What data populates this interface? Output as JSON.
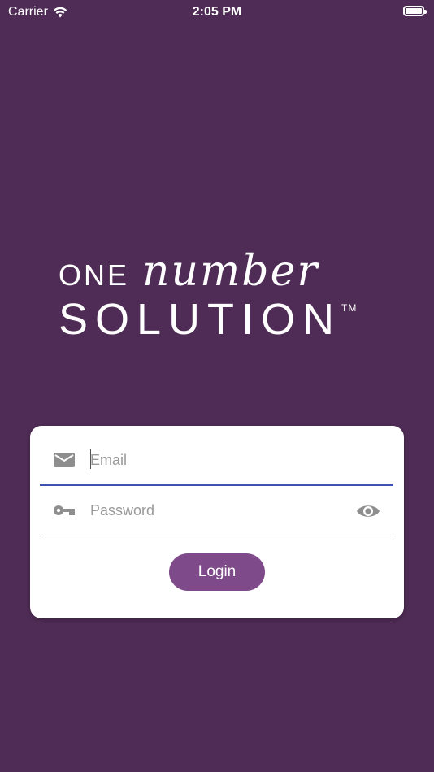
{
  "status_bar": {
    "carrier": "Carrier",
    "time": "2:05 PM"
  },
  "logo": {
    "line1_a": "ONE",
    "line1_b": "number",
    "line2": "SOLUTION",
    "trademark": "TM"
  },
  "login_form": {
    "email_placeholder": "Email",
    "email_value": "",
    "password_placeholder": "Password",
    "password_value": "",
    "login_label": "Login"
  },
  "colors": {
    "background": "#4f2c55",
    "button": "#7e4a8a",
    "focus_underline": "#3f51b5",
    "icon": "#8e8e8e"
  },
  "icons": {
    "wifi": "wifi-icon",
    "battery": "battery-icon",
    "email": "mail-icon",
    "password": "key-icon",
    "visibility": "eye-icon"
  }
}
